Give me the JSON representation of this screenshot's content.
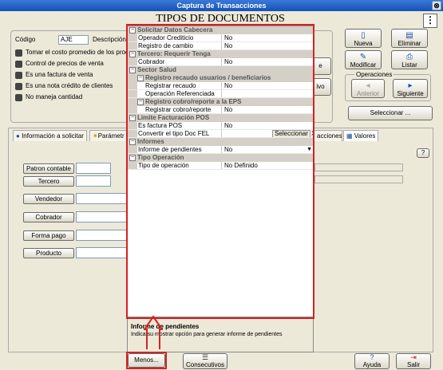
{
  "window": {
    "title": "Captura de Transacciones",
    "close": "⊗"
  },
  "doc_title": "TIPOS DE DOCUMENTOS",
  "menu_button": "⋮",
  "header": {
    "codigo_label": "Código",
    "codigo_value": "AJE",
    "descripcion_label": "Descripción"
  },
  "checks": [
    "Tomar el costo promedio de los produc",
    "Control de precios de venta",
    "Es una factura de venta",
    "Es una nota crédito de clientes",
    "No maneja cantidad"
  ],
  "hidden_btn_1": "e",
  "hidden_btn_2": "ivo",
  "actions": {
    "nueva": "Nueva",
    "eliminar": "Eliminar",
    "modificar": "Modificar",
    "listar": "Listar"
  },
  "operaciones": {
    "label": "Operaciones",
    "anterior": "Anterior",
    "siguiente": "Siguiente"
  },
  "seleccionar": "Seleccionar ...",
  "tabs": {
    "info": "Información a solicitar",
    "param": "Parámetr",
    "acciones": "acciones",
    "valores": "Valores"
  },
  "help_q": "?",
  "side_buttons": [
    "Patron contable",
    "Tercero",
    "Vendedor",
    "Cobrador",
    "Forma pago",
    "Producto"
  ],
  "grid": {
    "cat1": "Solicitar Datos Cabecera",
    "operador_credito_k": "Operador Crediticio",
    "operador_credito_v": "No",
    "registro_cambio_k": "Registro de cambio",
    "registro_cambio_v": "No",
    "cat2": "Tercero: Requerir Tenga",
    "cobrador_k": "Cobrador",
    "cobrador_v": "No",
    "cat3": "Sector Salud",
    "sub1": "Registro recaudo usuarios / beneficiarios",
    "registrar_recaudo_k": "Registrar recaudo",
    "registrar_recaudo_v": "No",
    "operacion_ref_k": "Operación Referenciada",
    "operacion_ref_v": "",
    "sub2": "Registro cobro/reporte a la EPS",
    "registrar_cobro_k": "Registrar cobro/reporte",
    "registrar_cobro_v": "No",
    "cat4": "Limite Facturación POS",
    "es_factura_pos_k": "Es factura POS",
    "es_factura_pos_v": "No",
    "convertir_fel_k": "Convertir el tipo Doc FEL",
    "convertir_fel_btn": "Seleccionar",
    "convertir_fel_x": "X",
    "cat5": "Informes",
    "informe_pend_k": "Informe de pendientes",
    "informe_pend_v": "No",
    "cat6": "Tipo Operación",
    "tipo_operacion_k": "Tipo de operación",
    "tipo_operacion_v": "No Definido"
  },
  "description": {
    "title": "Informe de pendientes",
    "text": "Indica su mostrar opción para generar informe de pendientes"
  },
  "bottom": {
    "menos": "Menos...",
    "consecutivos": "Consecutivos",
    "ayuda": "Ayuda",
    "salir": "Salir"
  }
}
